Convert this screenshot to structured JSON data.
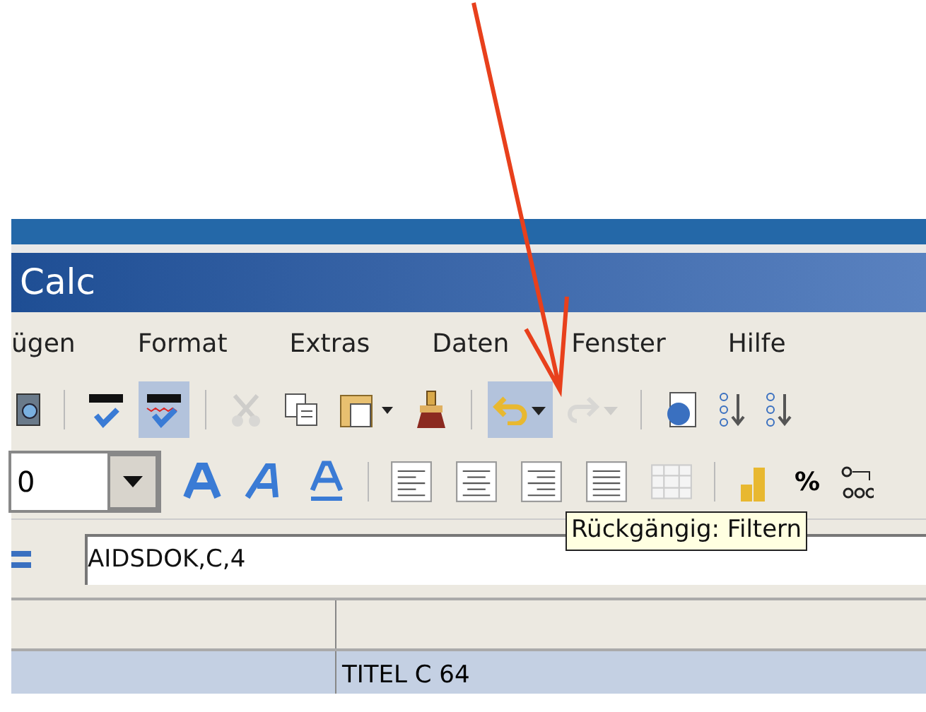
{
  "window": {
    "title": "Calc"
  },
  "menu": [
    "ügen",
    "Format",
    "Extras",
    "Daten",
    "Fenster",
    "Hilfe"
  ],
  "toolbar": [
    {
      "kind": "preview",
      "selected": false,
      "disabled": false
    },
    {
      "kind": "sep"
    },
    {
      "kind": "spell",
      "selected": false,
      "disabled": false
    },
    {
      "kind": "autospell",
      "selected": true,
      "disabled": false
    },
    {
      "kind": "sep"
    },
    {
      "kind": "cut",
      "selected": false,
      "disabled": true
    },
    {
      "kind": "copy",
      "selected": false,
      "disabled": false
    },
    {
      "kind": "paste",
      "selected": false,
      "disabled": false
    },
    {
      "kind": "brush",
      "selected": false,
      "disabled": false
    },
    {
      "kind": "sep"
    },
    {
      "kind": "undo",
      "selected": true,
      "disabled": false
    },
    {
      "kind": "redo",
      "selected": false,
      "disabled": true
    },
    {
      "kind": "sep"
    },
    {
      "kind": "navigator",
      "selected": false,
      "disabled": false
    },
    {
      "kind": "sort",
      "selected": false,
      "disabled": false
    },
    {
      "kind": "sort",
      "selected": false,
      "disabled": false
    }
  ],
  "font_size": {
    "value": "0"
  },
  "format_buttons": [
    {
      "kind": "bold"
    },
    {
      "kind": "italic"
    },
    {
      "kind": "underline"
    },
    {
      "kind": "sep"
    },
    {
      "kind": "left"
    },
    {
      "kind": "center"
    },
    {
      "kind": "right"
    },
    {
      "kind": "justify"
    },
    {
      "kind": "merge"
    },
    {
      "kind": "sep"
    },
    {
      "kind": "currency"
    },
    {
      "kind": "percent"
    },
    {
      "kind": "number"
    }
  ],
  "percent_label": "%",
  "formula": {
    "value": "AIDSDOK,C,4"
  },
  "tooltip": "Rückgängig: Filtern",
  "cell": "TITEL C 64"
}
